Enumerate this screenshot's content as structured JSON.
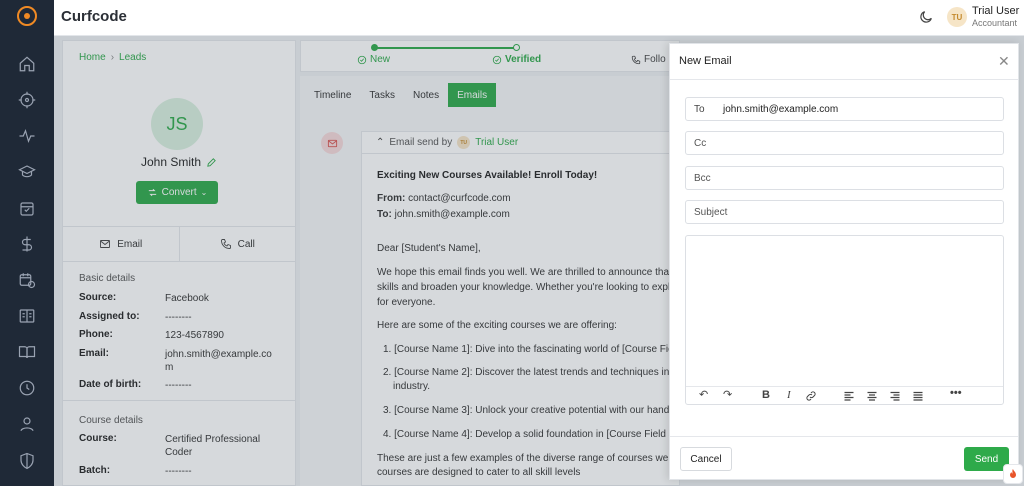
{
  "app": {
    "brand": "Curfcode"
  },
  "user": {
    "initials": "TU",
    "name": "Trial User",
    "role": "Accountant"
  },
  "nav": {
    "icons": [
      "home-icon",
      "target-icon",
      "activity-icon",
      "graduation-cap-icon",
      "layers-icon",
      "calendar-check-icon",
      "dollar-icon",
      "calendar-clock-icon",
      "book-open-icon",
      "book-icon",
      "clock-icon",
      "user-icon",
      "shield-icon"
    ]
  },
  "breadcrumb": {
    "home": "Home",
    "separator": "›",
    "current": "Leads"
  },
  "lead": {
    "initials": "JS",
    "name": "John Smith",
    "convert_label": "Convert",
    "email_label": "Email",
    "call_label": "Call",
    "basic_title": "Basic details",
    "basic": [
      {
        "key": "Source:",
        "value": "Facebook"
      },
      {
        "key": "Assigned to:",
        "value": "--------"
      },
      {
        "key": "Phone:",
        "value": "123-4567890"
      },
      {
        "key": "Email:",
        "value": "john.smith@example.com"
      },
      {
        "key": "Date of birth:",
        "value": "--------"
      }
    ],
    "course_title": "Course details",
    "course": [
      {
        "key": "Course:",
        "value": "Certified Professional Coder"
      },
      {
        "key": "Batch:",
        "value": "--------"
      }
    ]
  },
  "steps": [
    {
      "label": "New",
      "state": "done"
    },
    {
      "label": "Verified",
      "state": "current"
    },
    {
      "label": "Follo",
      "state": "upcoming"
    }
  ],
  "tabs": [
    {
      "label": "Timeline",
      "active": false
    },
    {
      "label": "Tasks",
      "active": false
    },
    {
      "label": "Notes",
      "active": false
    },
    {
      "label": "Emails",
      "active": true
    }
  ],
  "email": {
    "sent_by_label": "Email send by",
    "sender_initials": "TU",
    "sender": "Trial User",
    "subject": "Exciting New Courses Available! Enroll Today!",
    "from_label": "From:",
    "from": "contact@curfcode.com",
    "to_label": "To:",
    "to": "john.smith@example.com",
    "greeting": "Dear [Student's Name],",
    "intro": [
      "We hope this email finds you well. We are thrilled to announce that",
      "skills and broaden your knowledge. Whether you're looking to expl",
      "for everyone."
    ],
    "list_intro": "Here are some of the exciting courses we are offering:",
    "courses": [
      "1.  [Course Name 1]: Dive into the fascinating world of [Course Fiel",
      "2.  [Course Name 2]: Discover the latest trends and techniques in",
      "industry.",
      "3.  [Course Name 3]: Unlock your creative potential with our hand",
      "4.  [Course Name 4]: Develop a solid foundation in [Course Field 4"
    ],
    "outro": [
      "These are just a few examples of the diverse range of courses we",
      "courses are designed to cater to all skill levels"
    ]
  },
  "modal": {
    "title": "New Email",
    "to_label": "To",
    "to_value": "john.smith@example.com",
    "cc_placeholder": "Cc",
    "bcc_placeholder": "Bcc",
    "subject_placeholder": "Subject",
    "cancel_label": "Cancel",
    "send_label": "Send"
  },
  "colors": {
    "accent": "#2eaa4a",
    "nav_bg": "#1f2937",
    "logo": "#f08a24"
  }
}
